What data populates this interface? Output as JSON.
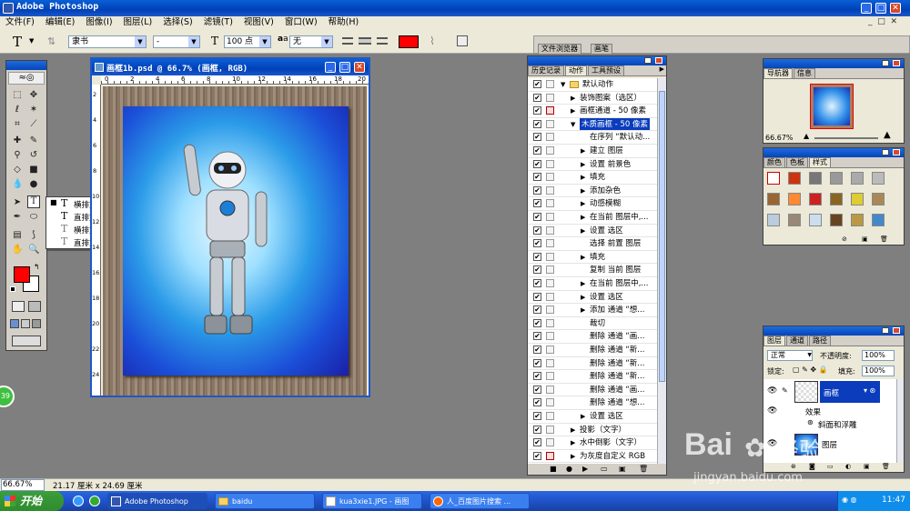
{
  "window": {
    "title": "Adobe Photoshop",
    "app_icon": "photoshop-icon"
  },
  "menu": [
    "文件(F)",
    "编辑(E)",
    "图像(I)",
    "图层(L)",
    "选择(S)",
    "滤镜(T)",
    "视图(V)",
    "窗口(W)",
    "帮助(H)"
  ],
  "options": {
    "tool": "T",
    "font_family": "隶书",
    "font_style": "-",
    "font_size": "100 点",
    "aa_label": "a",
    "antialias": "无",
    "text_color": "#ff0000",
    "well_tabs": [
      "文件浏览器",
      "画笔"
    ]
  },
  "document": {
    "title": "画框1b.psd @ 66.7% (画框, RGB)",
    "ruler_h": [
      "0",
      "2",
      "4",
      "6",
      "8",
      "10",
      "12",
      "14",
      "16",
      "18",
      "20"
    ],
    "ruler_v": [
      "2",
      "4",
      "6",
      "8",
      "10",
      "12",
      "14",
      "16",
      "18",
      "20",
      "22",
      "24"
    ]
  },
  "tool_flyout": [
    {
      "label": "横排文字工具",
      "key": "T",
      "selected": true,
      "icon": "T"
    },
    {
      "label": "直排文字工具",
      "key": "T",
      "selected": false,
      "icon": "T"
    },
    {
      "label": "横排文字蒙版工具",
      "key": "T",
      "selected": false,
      "icon": "T"
    },
    {
      "label": "直排文字蒙版工具",
      "key": "T",
      "selected": false,
      "icon": "T"
    }
  ],
  "actions_panel": {
    "tabs": [
      "历史记录",
      "动作",
      "工具预设"
    ],
    "active_tab": "动作",
    "rows": [
      {
        "label": "默认动作",
        "indent": 0,
        "arrow": "▼",
        "folder": true,
        "dlg": false,
        "selected": false
      },
      {
        "label": "装饰图案（选区）",
        "indent": 1,
        "arrow": "▶",
        "folder": false,
        "dlg": false,
        "selected": false
      },
      {
        "label": "画框通道 - 50 像素",
        "indent": 1,
        "arrow": "▶",
        "folder": false,
        "dlg": true,
        "selected": false
      },
      {
        "label": "木质画框 - 50 像素",
        "indent": 1,
        "arrow": "▼",
        "folder": false,
        "dlg": false,
        "selected": true
      },
      {
        "label": "在序列 “默认动...",
        "indent": 2,
        "arrow": "",
        "folder": false,
        "dlg": false,
        "selected": false
      },
      {
        "label": "建立 图层",
        "indent": 2,
        "arrow": "▶",
        "folder": false,
        "dlg": false,
        "selected": false
      },
      {
        "label": "设置 前景色",
        "indent": 2,
        "arrow": "▶",
        "folder": false,
        "dlg": false,
        "selected": false
      },
      {
        "label": "填充",
        "indent": 2,
        "arrow": "▶",
        "folder": false,
        "dlg": false,
        "selected": false
      },
      {
        "label": "添加杂色",
        "indent": 2,
        "arrow": "▶",
        "folder": false,
        "dlg": false,
        "selected": false
      },
      {
        "label": "动感模糊",
        "indent": 2,
        "arrow": "▶",
        "folder": false,
        "dlg": false,
        "selected": false
      },
      {
        "label": "在当前 图层中,...",
        "indent": 2,
        "arrow": "▶",
        "folder": false,
        "dlg": false,
        "selected": false
      },
      {
        "label": "设置 选区",
        "indent": 2,
        "arrow": "▶",
        "folder": false,
        "dlg": false,
        "selected": false
      },
      {
        "label": "选择 前置 图层",
        "indent": 2,
        "arrow": "",
        "folder": false,
        "dlg": false,
        "selected": false
      },
      {
        "label": "填充",
        "indent": 2,
        "arrow": "▶",
        "folder": false,
        "dlg": false,
        "selected": false
      },
      {
        "label": "复制 当前 图层",
        "indent": 2,
        "arrow": "",
        "folder": false,
        "dlg": false,
        "selected": false
      },
      {
        "label": "在当前 图层中,...",
        "indent": 2,
        "arrow": "▶",
        "folder": false,
        "dlg": false,
        "selected": false
      },
      {
        "label": "设置 选区",
        "indent": 2,
        "arrow": "▶",
        "folder": false,
        "dlg": false,
        "selected": false
      },
      {
        "label": "添加 通道 “想...",
        "indent": 2,
        "arrow": "▶",
        "folder": false,
        "dlg": false,
        "selected": false
      },
      {
        "label": "裁切",
        "indent": 2,
        "arrow": "",
        "folder": false,
        "dlg": false,
        "selected": false
      },
      {
        "label": "删除 通道 “画...",
        "indent": 2,
        "arrow": "",
        "folder": false,
        "dlg": false,
        "selected": false
      },
      {
        "label": "删除 通道 “新...",
        "indent": 2,
        "arrow": "",
        "folder": false,
        "dlg": false,
        "selected": false
      },
      {
        "label": "删除 通道 “新...",
        "indent": 2,
        "arrow": "",
        "folder": false,
        "dlg": false,
        "selected": false
      },
      {
        "label": "删除 通道 “新...",
        "indent": 2,
        "arrow": "",
        "folder": false,
        "dlg": false,
        "selected": false
      },
      {
        "label": "删除 通道 “画...",
        "indent": 2,
        "arrow": "",
        "folder": false,
        "dlg": false,
        "selected": false
      },
      {
        "label": "删除 通道 “想...",
        "indent": 2,
        "arrow": "",
        "folder": false,
        "dlg": false,
        "selected": false
      },
      {
        "label": "设置 选区",
        "indent": 2,
        "arrow": "▶",
        "folder": false,
        "dlg": false,
        "selected": false
      },
      {
        "label": "投影（文字）",
        "indent": 1,
        "arrow": "▶",
        "folder": false,
        "dlg": false,
        "selected": false
      },
      {
        "label": "水中倒影（文字）",
        "indent": 1,
        "arrow": "▶",
        "folder": false,
        "dlg": false,
        "selected": false
      },
      {
        "label": "为灰度自定义 RGB",
        "indent": 1,
        "arrow": "▶",
        "folder": false,
        "dlg": true,
        "selected": false
      }
    ]
  },
  "navigator": {
    "tabs": [
      "导航器",
      "信息"
    ],
    "zoom": "66.67%"
  },
  "swatches_panel": {
    "tabs": [
      "颜色",
      "色板",
      "样式"
    ],
    "styles": [
      "#ffffff",
      "#cc3311",
      "#777777",
      "#999999",
      "#aaaaaa",
      "#bbbbbb",
      "#996633",
      "#ff8833",
      "#cc2222",
      "#886622",
      "#ddcc33",
      "#aa8855",
      "#bbccdd",
      "#998877",
      "#ccddee",
      "#664422",
      "#bb9944",
      "#4488cc"
    ]
  },
  "layers_panel": {
    "tabs": [
      "图层",
      "通道",
      "路径"
    ],
    "blend_mode": "正常",
    "opacity_label": "不透明度:",
    "opacity": "100%",
    "lock_label": "锁定:",
    "fill_label": "填充:",
    "fill": "100%",
    "layer_name": "画框",
    "effects_label": "效果",
    "effect_name": "斜面和浮雕",
    "layer2_name": "图层"
  },
  "status": {
    "zoom": "66.67%",
    "doc_size": "21.17 厘米 x 24.69 厘米",
    "zoom_badge": "39"
  },
  "taskbar": {
    "start": "开始",
    "items": [
      "Adobe Photoshop",
      "baidu",
      "kua3xie1.JPG - 画图",
      "人_百度图片搜索 ..."
    ],
    "clock": "11:47"
  },
  "watermark": {
    "brand": "Bai",
    "brand2": "经验",
    "url": "jingyan.baidu.com"
  }
}
